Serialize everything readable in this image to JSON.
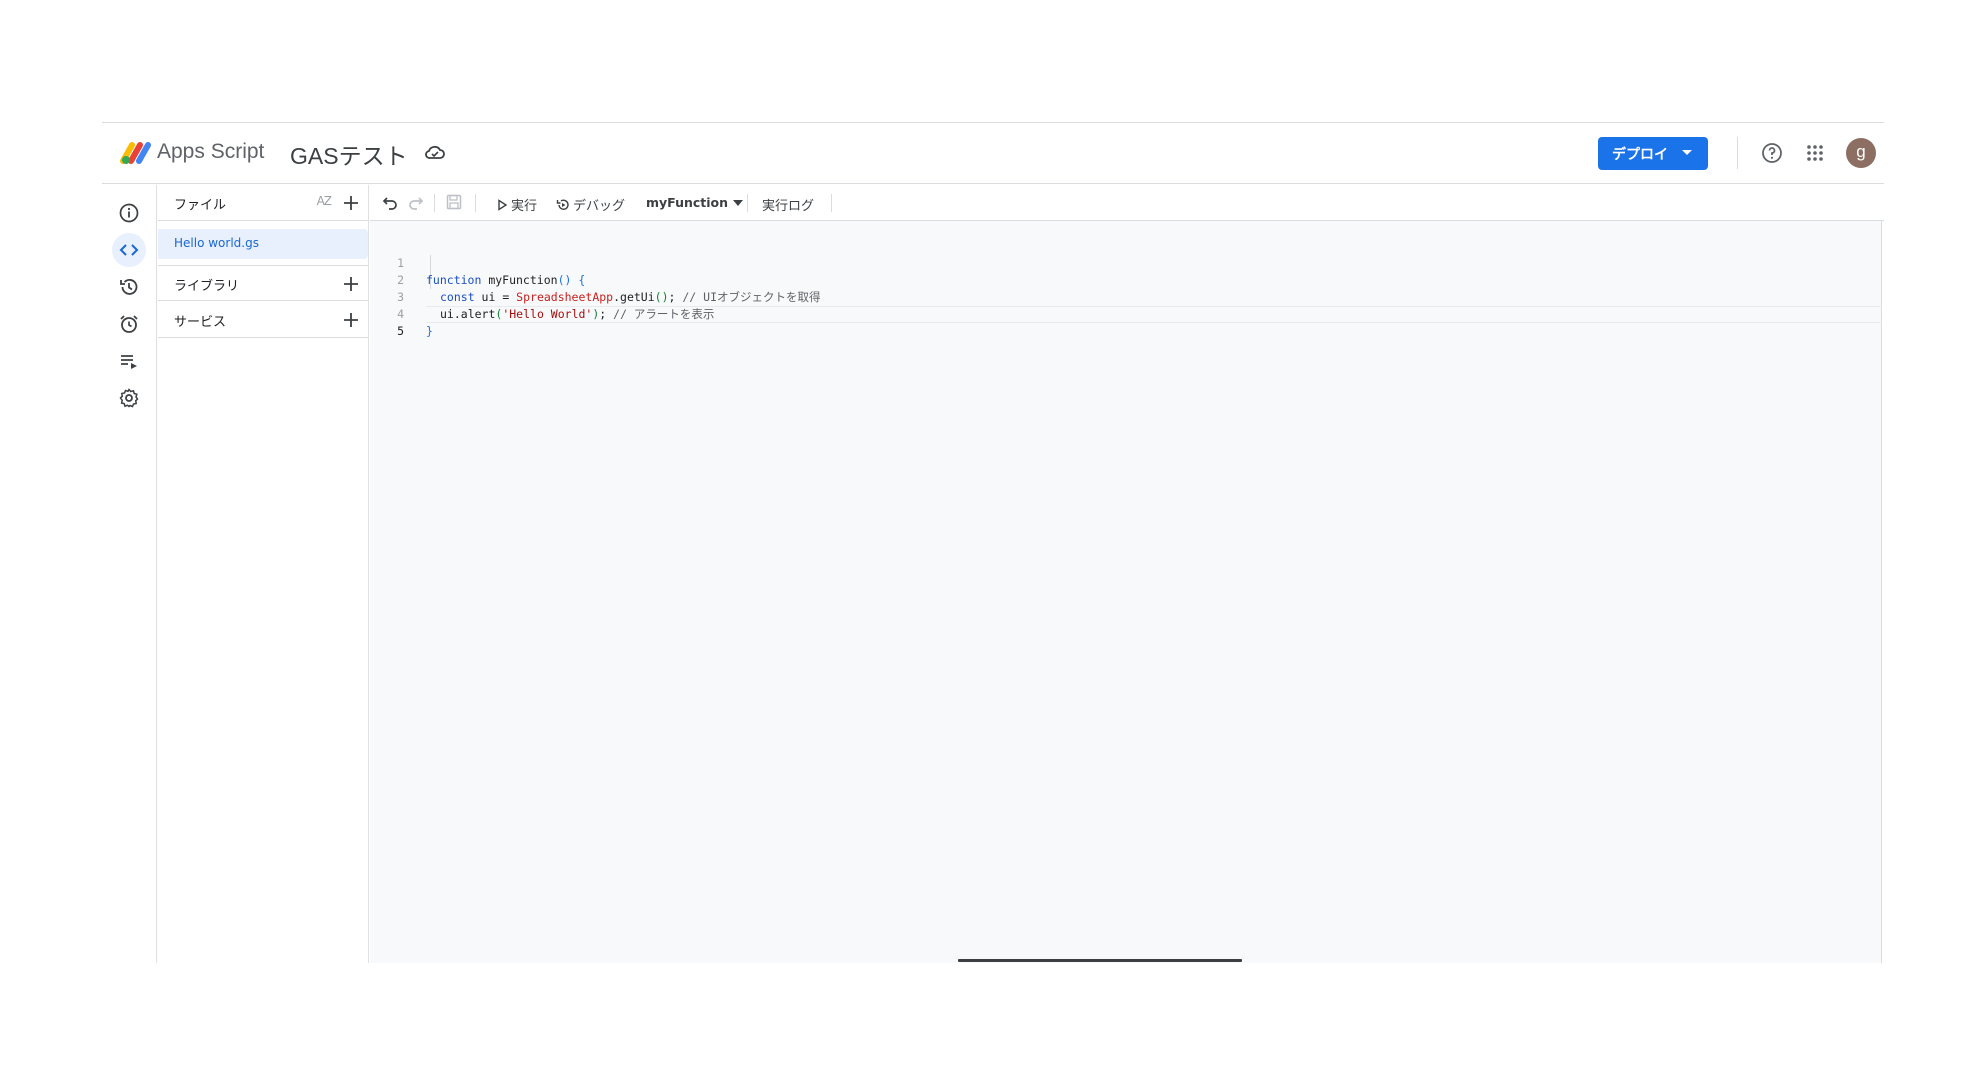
{
  "header": {
    "app_name": "Apps Script",
    "project_name": "GASテスト",
    "deploy_label": "デプロイ",
    "avatar_initial": "g",
    "accent_color": "#1a73e8"
  },
  "rail": {
    "items": [
      {
        "icon": "info-icon"
      },
      {
        "icon": "code-icon",
        "active": true
      },
      {
        "icon": "history-icon"
      },
      {
        "icon": "alarm-icon"
      },
      {
        "icon": "executions-icon"
      },
      {
        "icon": "settings-icon"
      }
    ]
  },
  "files": {
    "section_label": "ファイル",
    "sort_label": "AZ",
    "items": [
      {
        "name": "Hello world.gs",
        "selected": true
      }
    ],
    "libraries_label": "ライブラリ",
    "services_label": "サービス"
  },
  "toolbar": {
    "run_label": "実行",
    "debug_label": "デバッグ",
    "function_select": "myFunction",
    "log_label": "実行ログ"
  },
  "editor": {
    "line_numbers": [
      "1",
      "2",
      "3",
      "4",
      "5"
    ],
    "lines": {
      "l1_kw": "function",
      "l1_rest": " myFunction",
      "l1_paren": "()",
      "l1_brace": " {",
      "l2_kw": "const",
      "l2_a": " ui = ",
      "l2_cls": "SpreadsheetApp",
      "l2_b": ".getUi",
      "l2_paren": "()",
      "l2_c": "; ",
      "l2_cmt": "// UIオブジェクトを取得",
      "l3_a": "ui.alert",
      "l3_open": "(",
      "l3_str": "'Hello World'",
      "l3_close": ")",
      "l3_c": "; ",
      "l3_cmt": "// アラートを表示",
      "l4": "}"
    }
  }
}
